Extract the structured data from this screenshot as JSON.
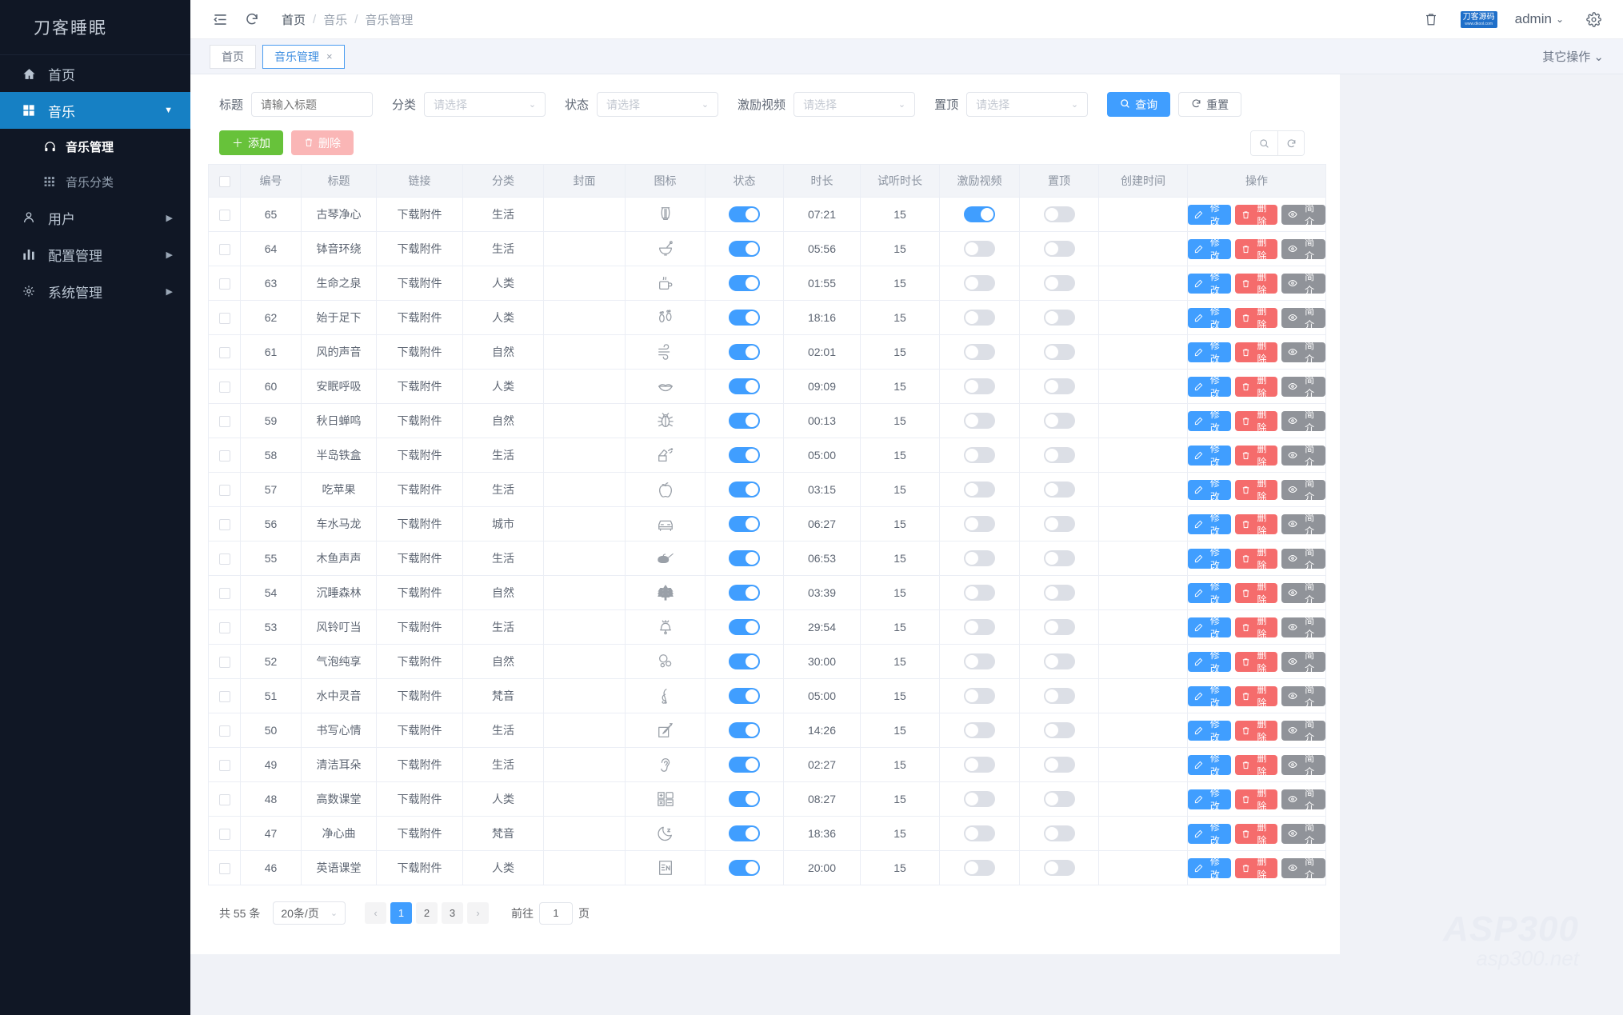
{
  "sidebar": {
    "logo": "刀客睡眠",
    "items": [
      {
        "label": "首页",
        "icon": "home-icon",
        "arrow": ""
      },
      {
        "label": "音乐",
        "icon": "grid-icon",
        "arrow": "▼",
        "active": true
      },
      {
        "label": "用户",
        "icon": "user-icon",
        "arrow": "▶"
      },
      {
        "label": "配置管理",
        "icon": "chart-icon",
        "arrow": "▶"
      },
      {
        "label": "系统管理",
        "icon": "gear-icon",
        "arrow": "▶"
      }
    ],
    "sub_items": [
      {
        "label": "音乐管理",
        "icon": "headphone-icon",
        "active": true
      },
      {
        "label": "音乐分类",
        "icon": "table-icon",
        "active": false
      }
    ]
  },
  "topbar": {
    "menu_icon": "collapse-icon",
    "refresh_icon": "refresh-icon",
    "breadcrumb": [
      "首页",
      "音乐",
      "音乐管理"
    ],
    "separator": "/",
    "trash_icon": "trash-icon",
    "brand_line1": "刀客源码",
    "brand_line2": "www.dkool.com",
    "user": "admin",
    "settings_icon": "gear-icon"
  },
  "tabs": {
    "items": [
      {
        "label": "首页",
        "closable": false,
        "active": false
      },
      {
        "label": "音乐管理",
        "closable": true,
        "active": true
      }
    ],
    "close_glyph": "×",
    "other_ops": "其它操作",
    "other_ops_caret": "⌄"
  },
  "filters": {
    "fields": [
      {
        "label": "标题",
        "type": "input",
        "value": "",
        "placeholder": "请输入标题"
      },
      {
        "label": "分类",
        "type": "select",
        "value": "请选择"
      },
      {
        "label": "状态",
        "type": "select",
        "value": "请选择"
      },
      {
        "label": "激励视频",
        "type": "select",
        "value": "请选择"
      },
      {
        "label": "置顶",
        "type": "select",
        "value": "请选择"
      }
    ],
    "search_label": "查询",
    "reset_label": "重置"
  },
  "toolbar": {
    "add_label": "添加",
    "add_glyph": "＋",
    "delete_label": "删除",
    "search_icon": "search-icon",
    "refresh_icon": "refresh-icon"
  },
  "table": {
    "columns": [
      "编号",
      "标题",
      "链接",
      "分类",
      "封面",
      "图标",
      "状态",
      "时长",
      "试听时长",
      "激励视频",
      "置顶",
      "创建时间",
      "操作"
    ],
    "link_text": "下载附件",
    "rows": [
      {
        "id": "65",
        "title": "古琴净心",
        "link": "下载附件",
        "category": "生活",
        "cover": "",
        "icon": "lyre-icon",
        "status": true,
        "duration": "07:21",
        "trial": "15",
        "reward": true,
        "top": false,
        "created": ""
      },
      {
        "id": "64",
        "title": "钵音环绕",
        "link": "下载附件",
        "category": "生活",
        "cover": "",
        "icon": "mortar-icon",
        "status": true,
        "duration": "05:56",
        "trial": "15",
        "reward": false,
        "top": false,
        "created": ""
      },
      {
        "id": "63",
        "title": "生命之泉",
        "link": "下载附件",
        "category": "人类",
        "cover": "",
        "icon": "hot-cup-icon",
        "status": true,
        "duration": "01:55",
        "trial": "15",
        "reward": false,
        "top": false,
        "created": ""
      },
      {
        "id": "62",
        "title": "始于足下",
        "link": "下载附件",
        "category": "人类",
        "cover": "",
        "icon": "footprints-icon",
        "status": true,
        "duration": "18:16",
        "trial": "15",
        "reward": false,
        "top": false,
        "created": ""
      },
      {
        "id": "61",
        "title": "风的声音",
        "link": "下载附件",
        "category": "自然",
        "cover": "",
        "icon": "wind-icon",
        "status": true,
        "duration": "02:01",
        "trial": "15",
        "reward": false,
        "top": false,
        "created": ""
      },
      {
        "id": "60",
        "title": "安眠呼吸",
        "link": "下载附件",
        "category": "人类",
        "cover": "",
        "icon": "lips-icon",
        "status": true,
        "duration": "09:09",
        "trial": "15",
        "reward": false,
        "top": false,
        "created": ""
      },
      {
        "id": "59",
        "title": "秋日蝉鸣",
        "link": "下载附件",
        "category": "自然",
        "cover": "",
        "icon": "bug-icon",
        "status": true,
        "duration": "00:13",
        "trial": "15",
        "reward": false,
        "top": false,
        "created": ""
      },
      {
        "id": "58",
        "title": "半岛铁盒",
        "link": "下载附件",
        "category": "生活",
        "cover": "",
        "icon": "music-box-icon",
        "status": true,
        "duration": "05:00",
        "trial": "15",
        "reward": false,
        "top": false,
        "created": ""
      },
      {
        "id": "57",
        "title": "吃苹果",
        "link": "下载附件",
        "category": "生活",
        "cover": "",
        "icon": "apple-icon",
        "status": true,
        "duration": "03:15",
        "trial": "15",
        "reward": false,
        "top": false,
        "created": ""
      },
      {
        "id": "56",
        "title": "车水马龙",
        "link": "下载附件",
        "category": "城市",
        "cover": "",
        "icon": "car-icon",
        "status": true,
        "duration": "06:27",
        "trial": "15",
        "reward": false,
        "top": false,
        "created": ""
      },
      {
        "id": "55",
        "title": "木鱼声声",
        "link": "下载附件",
        "category": "生活",
        "cover": "",
        "icon": "wood-fish-icon",
        "status": true,
        "duration": "06:53",
        "trial": "15",
        "reward": false,
        "top": false,
        "created": ""
      },
      {
        "id": "54",
        "title": "沉睡森林",
        "link": "下载附件",
        "category": "自然",
        "cover": "",
        "icon": "forest-icon",
        "status": true,
        "duration": "03:39",
        "trial": "15",
        "reward": false,
        "top": false,
        "created": ""
      },
      {
        "id": "53",
        "title": "风铃叮当",
        "link": "下载附件",
        "category": "生活",
        "cover": "",
        "icon": "bell-icon",
        "status": true,
        "duration": "29:54",
        "trial": "15",
        "reward": false,
        "top": false,
        "created": ""
      },
      {
        "id": "52",
        "title": "气泡纯享",
        "link": "下载附件",
        "category": "自然",
        "cover": "",
        "icon": "bubbles-icon",
        "status": true,
        "duration": "30:00",
        "trial": "15",
        "reward": false,
        "top": false,
        "created": ""
      },
      {
        "id": "51",
        "title": "水中灵音",
        "link": "下载附件",
        "category": "梵音",
        "cover": "",
        "icon": "clef-icon",
        "status": true,
        "duration": "05:00",
        "trial": "15",
        "reward": false,
        "top": false,
        "created": ""
      },
      {
        "id": "50",
        "title": "书写心情",
        "link": "下载附件",
        "category": "生活",
        "cover": "",
        "icon": "pencil-icon",
        "status": true,
        "duration": "14:26",
        "trial": "15",
        "reward": false,
        "top": false,
        "created": ""
      },
      {
        "id": "49",
        "title": "清洁耳朵",
        "link": "下载附件",
        "category": "生活",
        "cover": "",
        "icon": "ear-icon",
        "status": true,
        "duration": "02:27",
        "trial": "15",
        "reward": false,
        "top": false,
        "created": ""
      },
      {
        "id": "48",
        "title": "高数课堂",
        "link": "下载附件",
        "category": "人类",
        "cover": "",
        "icon": "calculator-icon",
        "status": true,
        "duration": "08:27",
        "trial": "15",
        "reward": false,
        "top": false,
        "created": ""
      },
      {
        "id": "47",
        "title": "净心曲",
        "link": "下载附件",
        "category": "梵音",
        "cover": "",
        "icon": "moon-icon",
        "status": true,
        "duration": "18:36",
        "trial": "15",
        "reward": false,
        "top": false,
        "created": ""
      },
      {
        "id": "46",
        "title": "英语课堂",
        "link": "下载附件",
        "category": "人类",
        "cover": "",
        "icon": "english-icon",
        "status": true,
        "duration": "20:00",
        "trial": "15",
        "reward": false,
        "top": false,
        "created": ""
      }
    ],
    "row_actions": [
      {
        "key": "edit",
        "label": "修改",
        "icon": "pencil-icon"
      },
      {
        "key": "del",
        "label": "删除",
        "icon": "trash-icon"
      },
      {
        "key": "info",
        "label": "简介",
        "icon": "eye-icon"
      }
    ]
  },
  "pagination": {
    "total_text": "共 55 条",
    "page_size": "20条/页",
    "prev_glyph": "‹",
    "next_glyph": "›",
    "pages": [
      "1",
      "2",
      "3"
    ],
    "current_page": "1",
    "jump_prefix": "前往",
    "jump_value": "1",
    "jump_suffix": "页"
  },
  "watermark": {
    "line1": "ASP300",
    "line2": "asp300.net"
  },
  "colors": {
    "accent": "#409eff",
    "sidebar_bg": "#101725",
    "sidebar_active": "#1680c4",
    "success": "#67c23a",
    "danger": "#f56c6c",
    "info": "#909399"
  }
}
